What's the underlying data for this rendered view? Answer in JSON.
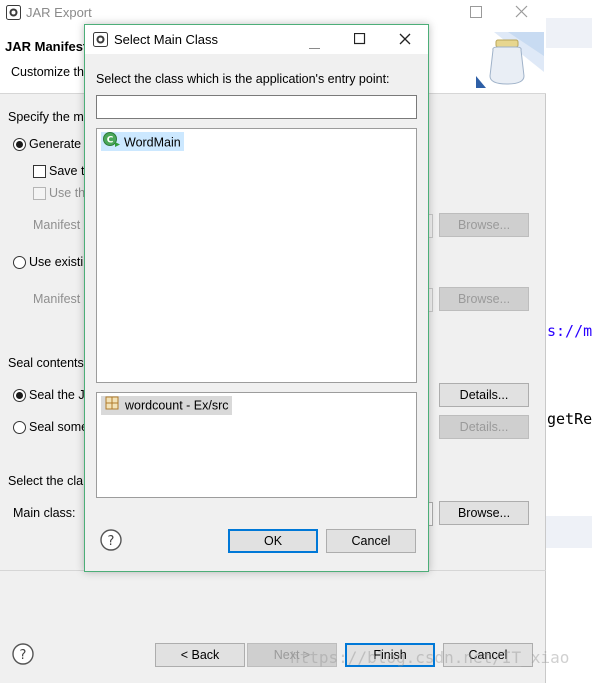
{
  "background_editor": {
    "code_line_1": "s://ma",
    "code_line_2": "getRe"
  },
  "jar_export": {
    "window_title": "JAR Export",
    "header_title": "JAR Manifest",
    "header_subtitle": "Customize th",
    "section_specify": "Specify the m",
    "option_generate": "Generate",
    "option_save": "Save t",
    "option_use": "Use th",
    "manifest_label_1": "Manifest",
    "option_use_existing": "Use existi",
    "manifest_label_2": "Manifest",
    "browse_label": "Browse...",
    "section_seal": "Seal contents",
    "option_seal_jar": "Seal the J",
    "option_seal_some": "Seal some",
    "details_label": "Details...",
    "section_select_class": "Select the cla",
    "main_class_label": "Main class:",
    "back_label": "< Back",
    "next_label": "Next >",
    "finish_label": "Finish",
    "cancel_label": "Cancel",
    "watermark": "https://blog.csdn.net/IT_xiao"
  },
  "dialog": {
    "title": "Select Main Class",
    "prompt": "Select the class which is the application's entry point:",
    "search_value": "",
    "classes": [
      "WordMain"
    ],
    "packages": [
      "wordcount - Ex/src"
    ],
    "ok_label": "OK",
    "cancel_label": "Cancel"
  }
}
